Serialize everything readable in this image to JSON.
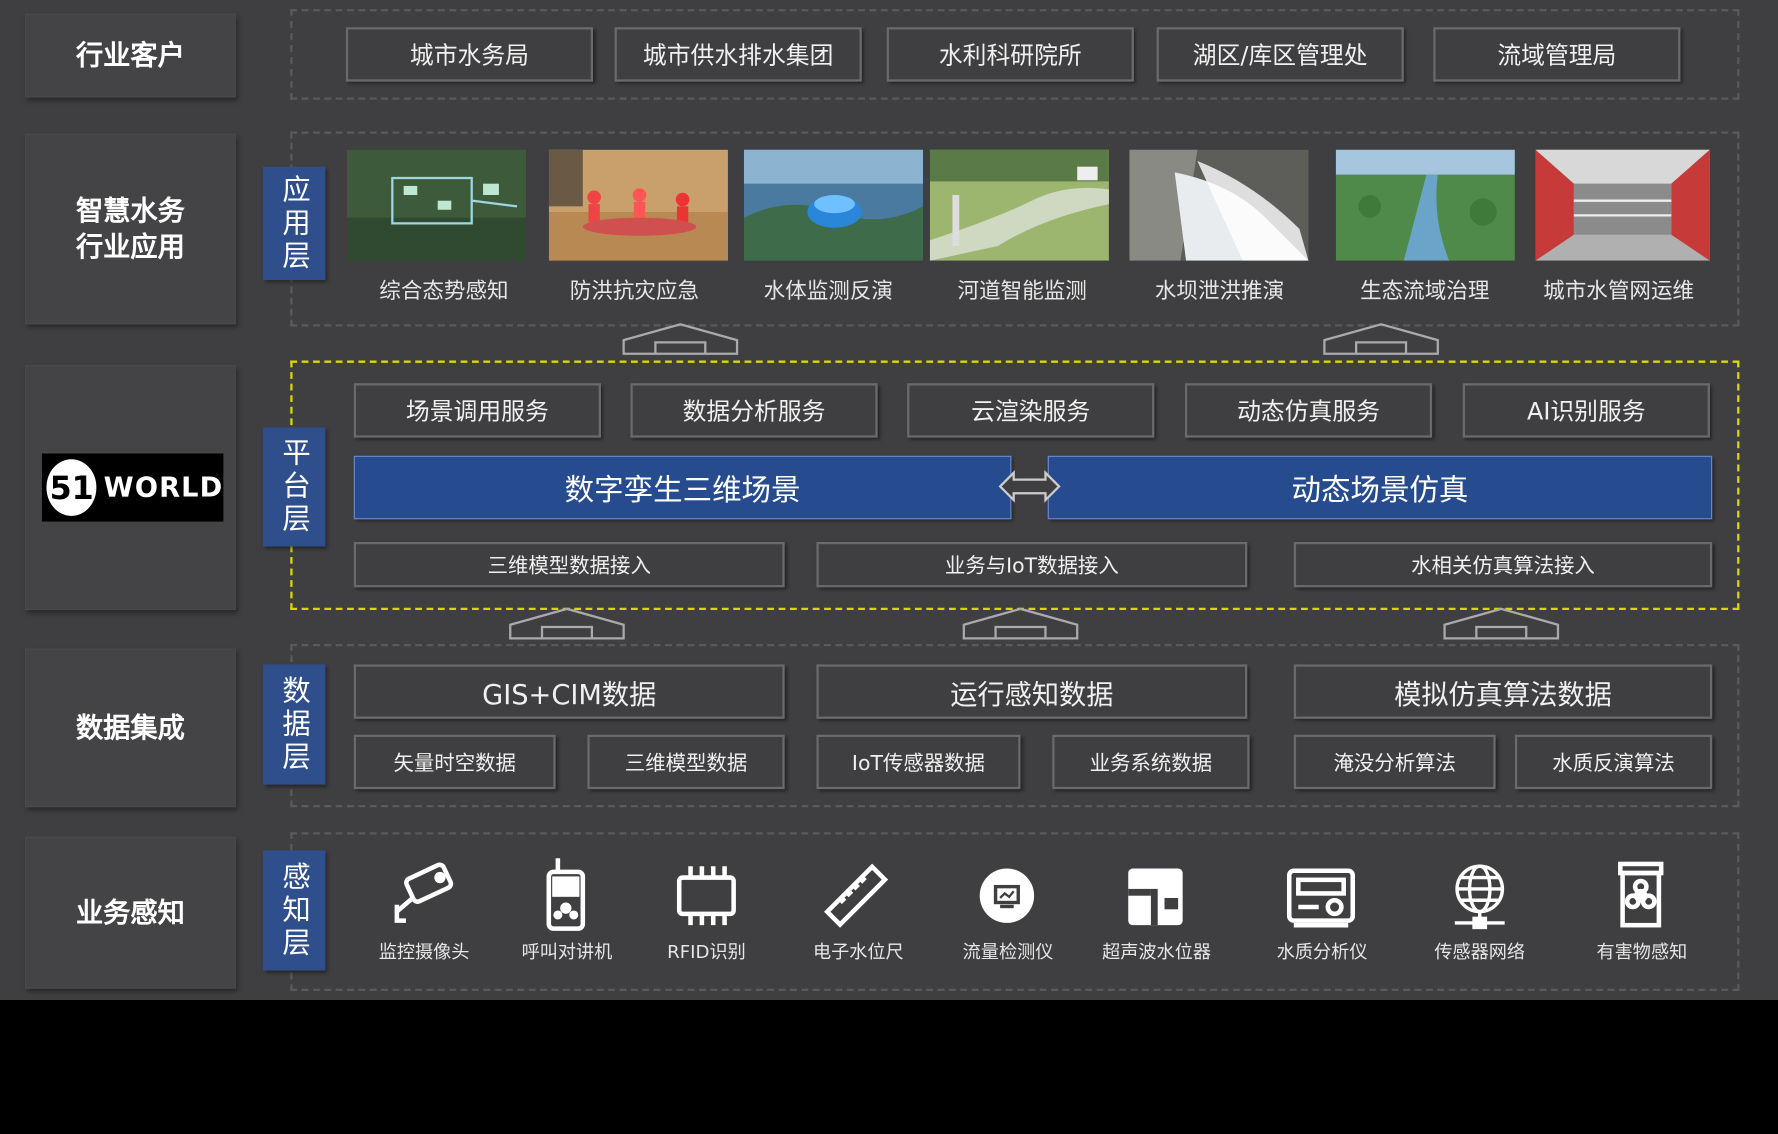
{
  "rows": {
    "customers": "行业客户",
    "apps": "智慧水务\n行业应用",
    "data": "数据集成",
    "sensing": "业务感知"
  },
  "logo": {
    "mark": "51",
    "word": "WORLD"
  },
  "layers": {
    "app": "应用层",
    "platform": "平台层",
    "data": "数据层",
    "sense": "感知层"
  },
  "customers": [
    "城市水务局",
    "城市供水排水集团",
    "水利科研院所",
    "湖区/库区管理处",
    "流域管理局"
  ],
  "applications": [
    "综合态势感知",
    "防洪抗灾应急",
    "水体监测反演",
    "河道智能监测",
    "水坝泄洪推演",
    "生态流域治理",
    "城市水管网运维"
  ],
  "platform": {
    "services": [
      "场景调用服务",
      "数据分析服务",
      "云渲染服务",
      "动态仿真服务",
      "AI识别服务"
    ],
    "bars": [
      "数字孪生三维场景",
      "动态场景仿真"
    ],
    "inputs": [
      "三维模型数据接入",
      "业务与IoT数据接入",
      "水相关仿真算法接入"
    ]
  },
  "data_layer": {
    "groups": [
      "GIS+CIM数据",
      "运行感知数据",
      "模拟仿真算法数据"
    ],
    "items": [
      "矢量时空数据",
      "三维模型数据",
      "IoT传感器数据",
      "业务系统数据",
      "淹没分析算法",
      "水质反演算法"
    ]
  },
  "sensors": [
    {
      "label": "监控摄像头",
      "icon": "camera-icon"
    },
    {
      "label": "呼叫对讲机",
      "icon": "walkie-talkie-icon"
    },
    {
      "label": "RFID识别",
      "icon": "rfid-chip-icon"
    },
    {
      "label": "电子水位尺",
      "icon": "ruler-icon"
    },
    {
      "label": "流量检测仪",
      "icon": "flow-meter-icon"
    },
    {
      "label": "超声波水位器",
      "icon": "ultrasonic-icon"
    },
    {
      "label": "水质分析仪",
      "icon": "analyzer-icon"
    },
    {
      "label": "传感器网络",
      "icon": "network-globe-icon"
    },
    {
      "label": "有害物感知",
      "icon": "biohazard-icon"
    }
  ],
  "colors": {
    "background": "#3f3f41",
    "accent_blue": "#274b8f",
    "highlight_yellow": "#d9d900"
  }
}
